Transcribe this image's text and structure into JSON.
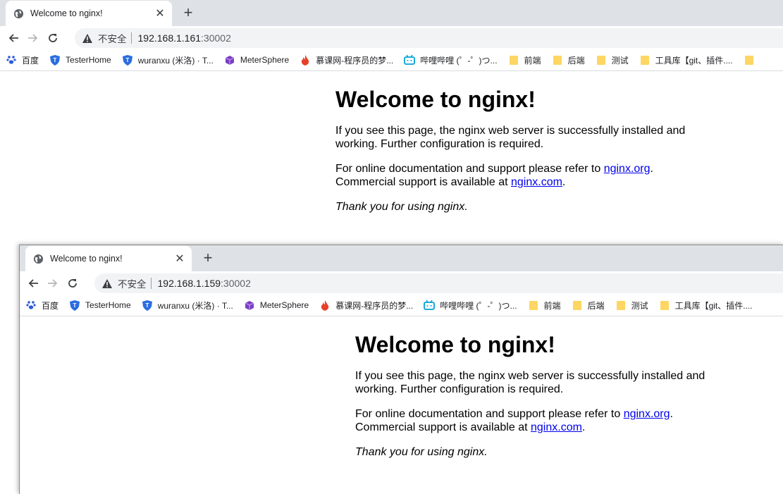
{
  "windows": [
    {
      "tab": {
        "title": "Welcome to nginx!"
      },
      "address": {
        "security_label": "不安全",
        "host": "192.168.1.161",
        "port": ":30002"
      }
    },
    {
      "tab": {
        "title": "Welcome to nginx!"
      },
      "address": {
        "security_label": "不安全",
        "host": "192.168.1.159",
        "port": ":30002"
      }
    }
  ],
  "bookmarks": [
    {
      "label": "百度",
      "icon": "paw-icon"
    },
    {
      "label": "TesterHome",
      "icon": "shield-icon"
    },
    {
      "label": "wuranxu (米洛) · T...",
      "icon": "shield-icon"
    },
    {
      "label": "MeterSphere",
      "icon": "cube-icon"
    },
    {
      "label": "慕课网-程序员的梦...",
      "icon": "flame-icon"
    },
    {
      "label": "哔哩哔哩 (゜-゜)つ...",
      "icon": "tv-icon"
    },
    {
      "label": "前端",
      "icon": "folder-icon"
    },
    {
      "label": "后端",
      "icon": "folder-icon"
    },
    {
      "label": "测试",
      "icon": "folder-icon"
    },
    {
      "label": "工具库【git、插件....",
      "icon": "folder-icon"
    }
  ],
  "page": {
    "heading": "Welcome to nginx!",
    "p1": "If you see this page, the nginx web server is successfully installed and working. Further configuration is required.",
    "p2_a": "For online documentation and support please refer to ",
    "p2_link1": "nginx.org",
    "p2_b": ".",
    "p2_c": "Commercial support is available at ",
    "p2_link2": "nginx.com",
    "p2_d": ".",
    "p3": "Thank you for using nginx."
  },
  "colors": {
    "tabstrip": "#dee1e6",
    "omnibox": "#f1f3f4",
    "link": "#0000ee",
    "folder": "#fdd663"
  }
}
